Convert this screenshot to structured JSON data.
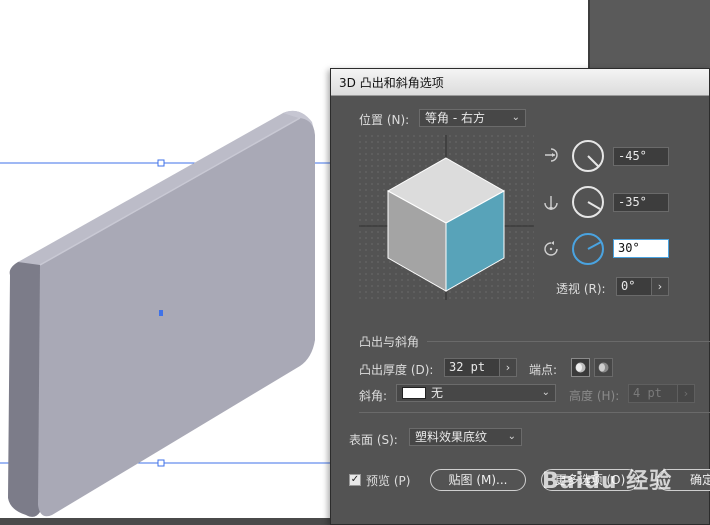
{
  "dialog": {
    "title": "3D 凸出和斜角选项",
    "position_label": "位置 (N):",
    "position_value": "等角 - 右方",
    "rotation": {
      "x": "-45°",
      "y": "-35°",
      "z": "30°"
    },
    "perspective_label": "透视 (R):",
    "perspective_value": "0°",
    "extrude_bevel_heading": "凸出与斜角",
    "extrude_depth_label": "凸出厚度 (D):",
    "extrude_depth_value": "32 pt",
    "cap_label": "端点:",
    "bevel_label": "斜角:",
    "bevel_value": "无",
    "height_label": "高度 (H):",
    "height_value": "4 pt",
    "surface_label": "表面 (S):",
    "surface_value": "塑料效果底纹",
    "preview_label": "预览 (P)",
    "preview_checked": true,
    "map_art_button": "贴图 (M)...",
    "more_options_button": "更多选项 (O)",
    "ok_button": "确定"
  },
  "colors": {
    "accent": "#4aa3e0",
    "cube_top": "#dcdcdc",
    "cube_left": "#a4a4a4",
    "cube_right": "#58a3b9",
    "object_face": "#a9a9b6",
    "selection_guide": "#3f72e8"
  },
  "icons": [
    "rotate-x-icon",
    "rotate-y-icon",
    "rotate-z-icon",
    "cap-on-icon",
    "cap-off-icon",
    "chevron-down-icon",
    "chevron-right-icon",
    "checkbox-icon"
  ],
  "watermark": "Baidu 经验"
}
